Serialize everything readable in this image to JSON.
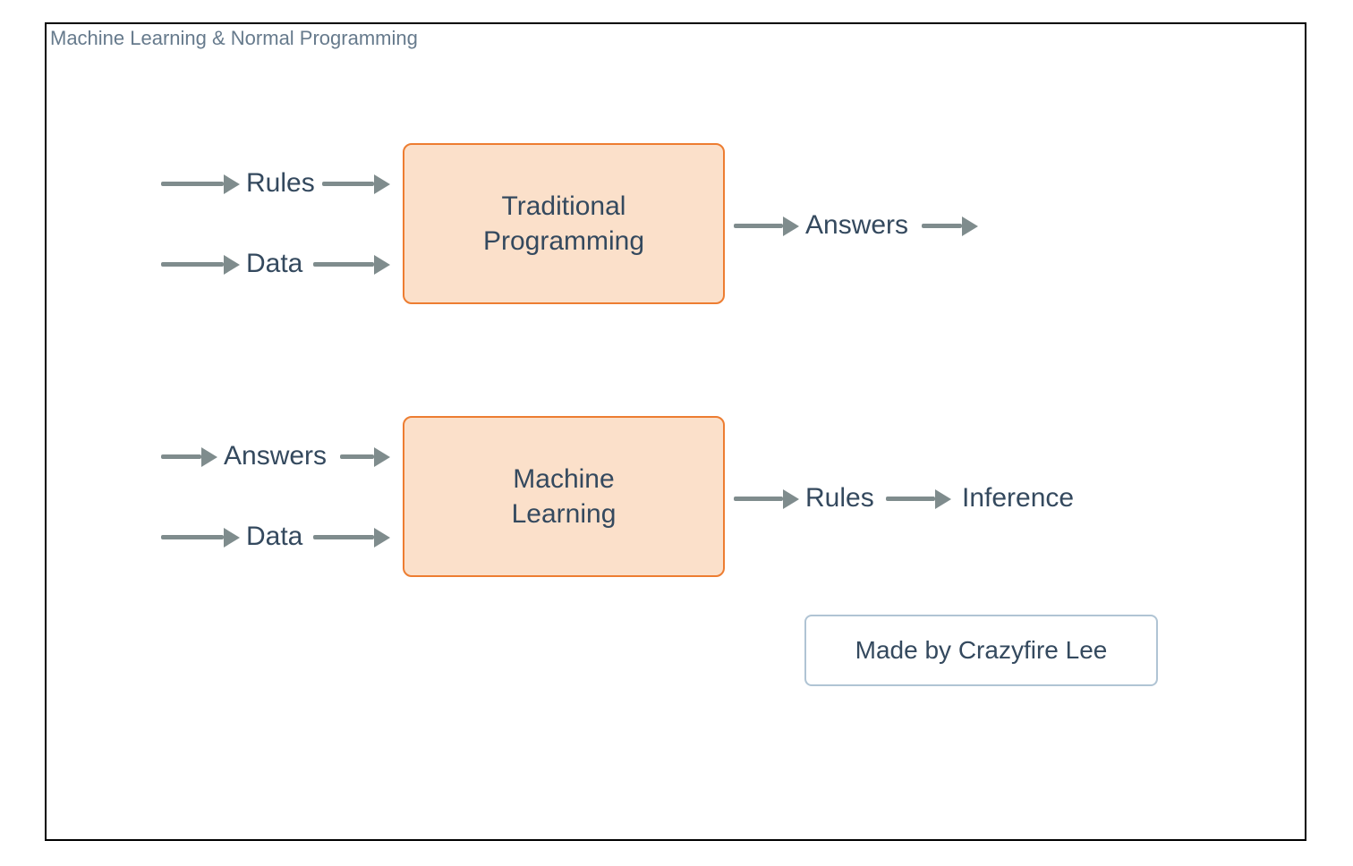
{
  "title": "Machine Learning & Normal Programming",
  "traditional": {
    "box_label": "Traditional\nProgramming",
    "input1": "Rules",
    "input2": "Data",
    "output1": "Answers"
  },
  "ml": {
    "box_label": "Machine\nLearning",
    "input1": "Answers",
    "input2": "Data",
    "output1": "Rules",
    "output2": "Inference"
  },
  "credit": "Made by Crazyfire Lee",
  "colors": {
    "box_fill": "#fbe0ca",
    "box_border": "#ed7d31",
    "arrow": "#7f8c8d",
    "text": "#34495e",
    "title": "#667a8c",
    "credit_border": "#b0c4d4"
  }
}
